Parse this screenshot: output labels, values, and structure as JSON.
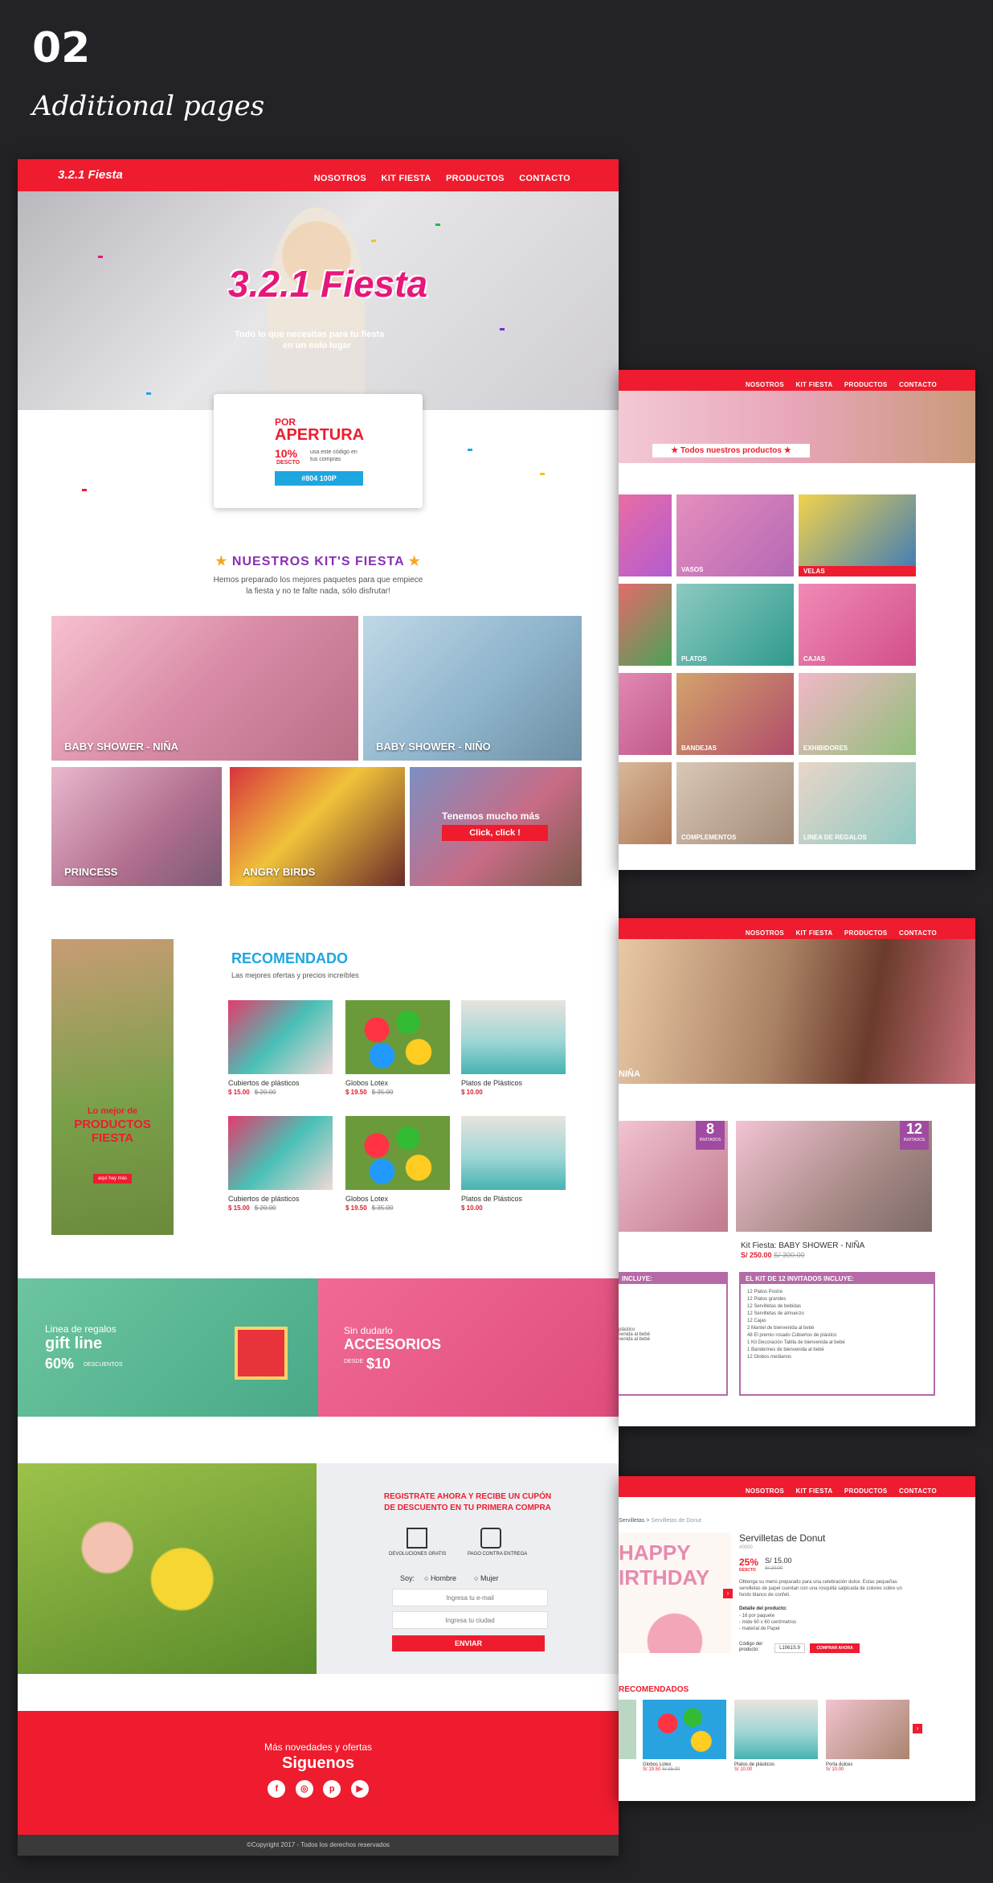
{
  "section": {
    "number": "02",
    "title": "Additional pages"
  },
  "nav": {
    "logo": "3.2.1 Fiesta",
    "items": [
      "NOSOTROS",
      "KIT FIESTA",
      "PRODUCTOS",
      "CONTACTO"
    ]
  },
  "home": {
    "hero_logo": "3.2.1 Fiesta",
    "hero_tagline_1": "Todo lo que necesitas para tu fiesta",
    "hero_tagline_2": "en un solo lugar",
    "promo": {
      "line1": "POR",
      "line2": "APERTURA",
      "percent": "10%",
      "desc": "DESCTO",
      "note": "usa este código en tus compras",
      "code": "#804 100P"
    },
    "kits": {
      "title": "NUESTROS KIT'S FIESTA",
      "subtitle_1": "Hemos preparado los mejores paquetes para que empiece",
      "subtitle_2": "la fiesta y no te falte nada, sólo disfrutar!",
      "tiles": [
        "BABY SHOWER - NIÑA",
        "BABY SHOWER - NIÑO",
        "PRINCESS",
        "ANGRY BIRDS"
      ],
      "more_text": "Tenemos mucho más",
      "more_button": "Click, click !"
    },
    "recommended": {
      "title": "RECOMENDADO",
      "subtitle": "Las mejores ofertas y precios increíbles",
      "promo_1": "Lo mejor de",
      "promo_2": "PRODUCTOS FIESTA",
      "promo_button": "aquí hay más",
      "products": [
        {
          "name": "Cubiertos de plásticos",
          "price": "$ 15.00",
          "old": "$ 20.00"
        },
        {
          "name": "Globos Lotex",
          "price": "$ 19.50",
          "old": "$ 35.00"
        },
        {
          "name": "Platos de Plásticos",
          "price": "$ 10.00",
          "old": ""
        },
        {
          "name": "Cubiertos de plásticos",
          "price": "$ 15.00",
          "old": "$ 20.00"
        },
        {
          "name": "Globos Lotex",
          "price": "$ 19.50",
          "old": "$ 35.00"
        },
        {
          "name": "Platos de Plásticos",
          "price": "$ 10.00",
          "old": ""
        }
      ]
    },
    "banners": {
      "gift_1": "Linea de regalos",
      "gift_2": "gift line",
      "gift_3": "60%",
      "gift_4": "DESCUENTOS",
      "acc_1": "Sin dudarlo",
      "acc_2": "ACCESORIOS",
      "acc_3": "DESDE",
      "acc_4": "$10"
    },
    "signup": {
      "title_1": "REGISTRATE AHORA Y RECIBE UN CUPÓN",
      "title_2": "DE DESCUENTO EN TU PRIMERA COMPRA",
      "feature_1": "DEVOLUCIONES GRATIS",
      "feature_2": "PAGO CONTRA ENTREGA",
      "soy": "Soy:",
      "hombre": "Hombre",
      "mujer": "Mujer",
      "email_placeholder": "Ingresa tu e-mail",
      "city_placeholder": "Ingresa tu ciudad",
      "submit": "ENVIAR"
    },
    "footer": {
      "line": "Más novedades y ofertas",
      "follow": "Siguenos",
      "copyright": "©Copyright 2017 - Todos los derechos reservados"
    }
  },
  "products_page": {
    "banner": "Todos nuestros productos",
    "categories": [
      "VASOS",
      "VELAS",
      "PLATOS",
      "CAJAS",
      "BANDEJAS",
      "EXHIBIDORES",
      "COMPLEMENTOS",
      "LINEA DE REGALOS"
    ]
  },
  "kit_page": {
    "hero_label": "NIÑA",
    "guests_1": "8",
    "guests_2": "12",
    "guests_label": "INVITADOS",
    "kit_name": "Kit Fiesta: BABY SHOWER - NIÑA",
    "kit_price": "S/ 250.00",
    "kit_old": "S/ 300.00",
    "includes_left": "INCLUYE:",
    "includes_title": "EL KIT DE 12 INVITADOS INCLUYE:",
    "items": [
      "12 Platos Postre",
      "12 Platos grandes",
      "12 Servilletas de bebidas",
      "12 Servilletas de almuerzo",
      "12 Cajas",
      "2 Mantel de bienvenida al bebé",
      "48 El premio rosado Cubiertos de plástico",
      "1 Kit Decoración Tablla de bienvenida al bebé",
      "1 Banderines de bienvenida al bebé",
      "12 Globos medianos"
    ],
    "left_items": [
      "plástico",
      "venida al bebé",
      "venida al bebé"
    ]
  },
  "detail_page": {
    "breadcrumb_1": "Servilletas",
    "breadcrumb_2": "Servilletas de Donut",
    "title": "Servilletas de Donut",
    "sku": "#0000",
    "percent": "25%",
    "desc_label": "DESCTO",
    "price": "S/ 15.00",
    "old": "S/ 20.00",
    "description": "Obtenga su menú preparado para una celebración dulce. Estas pequeñas servilletas de papel cuentan con una rosquilla salpicada de colores sobre un fondo blanco de confeti.",
    "details_title": "Detalle del producto:",
    "details": [
      "16 por paquete",
      "mide 60 x 60 centímetros",
      "material de Papel"
    ],
    "code_label": "Código del producto:",
    "code": "L1061S.9",
    "buy": "COMPRAR AHORA",
    "image_text_1": "HAPPY",
    "image_text_2": "IRTHDAY",
    "recommended_title": "RECOMENDADOS",
    "recommended": [
      {
        "name": "Globos Lotex",
        "price": "S/ 19.50",
        "old": "S/ 35.00"
      },
      {
        "name": "Platos de plásticos",
        "price": "S/ 10.00",
        "old": ""
      },
      {
        "name": "Porta dulces",
        "price": "S/ 10.00",
        "old": ""
      }
    ]
  }
}
